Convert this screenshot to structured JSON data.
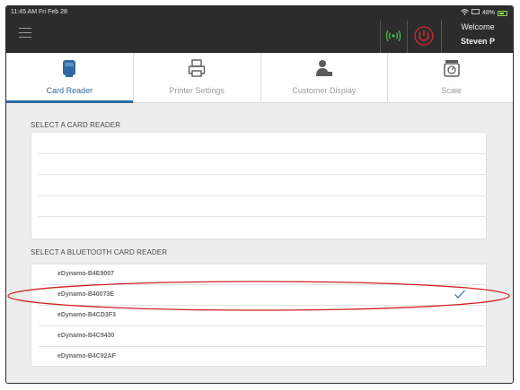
{
  "status_bar": {
    "time": "11:45 AM  Fri Feb 28",
    "battery": "48%"
  },
  "header": {
    "welcome_line1": "Welcome",
    "welcome_line2": "Steven P"
  },
  "tabs": [
    {
      "label": "Card Reader",
      "icon": "card-reader-icon",
      "active": true
    },
    {
      "label": "Printer Settings",
      "icon": "printer-icon",
      "active": false
    },
    {
      "label": "Customer Display",
      "icon": "customer-display-icon",
      "active": false
    },
    {
      "label": "Scale",
      "icon": "scale-icon",
      "active": false
    }
  ],
  "card_reader_section": {
    "title": "SELECT A CARD READER",
    "rows": [
      "",
      "",
      "",
      "",
      ""
    ]
  },
  "bluetooth_section": {
    "title": "SELECT A BLUETOOTH CARD READER",
    "devices": [
      {
        "name": "eDynamo-B4E9007",
        "selected": false
      },
      {
        "name": "eDynamo-B40073E",
        "selected": true
      },
      {
        "name": "eDynamo-B4CD3F3",
        "selected": false
      },
      {
        "name": "eDynamo-B4C9430",
        "selected": false
      },
      {
        "name": "eDynamo-B4C92AF",
        "selected": false
      }
    ]
  },
  "colors": {
    "accent": "#2e6aa1",
    "wifi_green": "#3ec43e",
    "power_red": "#d42b2b",
    "annotation_red": "#d21f1f",
    "topbar": "#2c2c2c"
  }
}
